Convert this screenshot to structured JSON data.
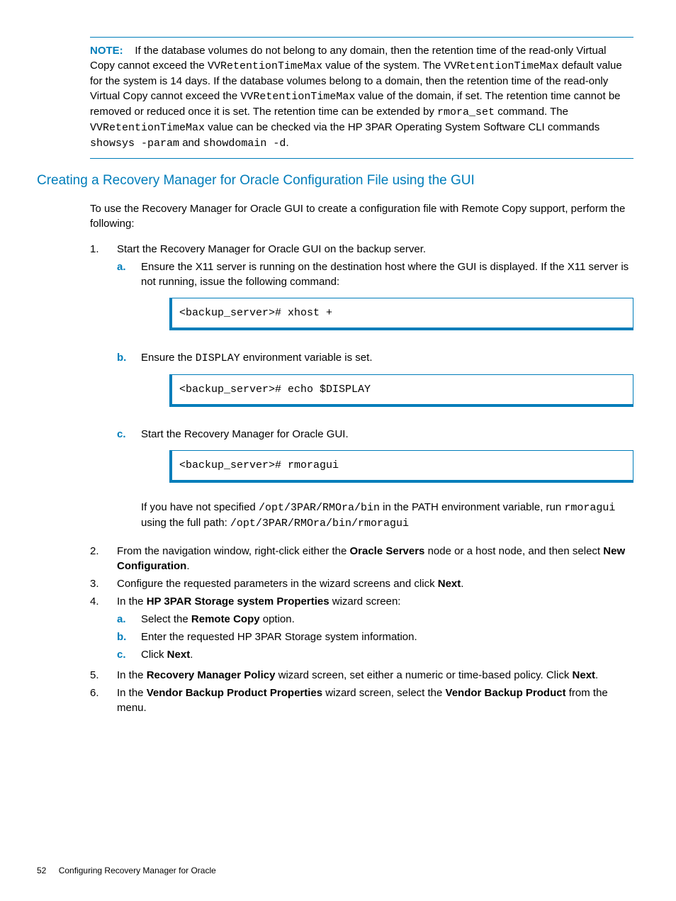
{
  "note": {
    "label": "NOTE:",
    "t1": "If the database volumes do not belong to any domain, then the retention time of the read-only Virtual Copy cannot exceed the ",
    "c1": "VVRetentionTimeMax",
    "t2": " value of the system. The ",
    "c2": "VVRetentionTimeMax",
    "t3": " default value for the system is 14 days. If the database volumes belong to a domain, then the retention time of the read-only Virtual Copy cannot exceed the ",
    "c3": "VVRetentionTimeMax",
    "t4": " value of the domain, if set. The retention time cannot be removed or reduced once it is set. The retention time can be extended by ",
    "c4": "rmora_set",
    "t5": " command. The ",
    "c5": "VVRetentionTimeMax",
    "t6": " value can be checked via the HP 3PAR Operating System Software CLI commands ",
    "c6": "showsys -param",
    "t7": " and ",
    "c7": "showdomain -d",
    "t8": "."
  },
  "heading": "Creating a Recovery Manager for Oracle Configuration File using the GUI",
  "intro": "To use the Recovery Manager for Oracle GUI to create a configuration file with Remote Copy support, perform the following:",
  "step1": {
    "num": "1.",
    "text": "Start the Recovery Manager for Oracle GUI on the backup server.",
    "a": {
      "m": "a.",
      "text": "Ensure the X11 server is running on the destination host where the GUI is displayed. If the X11 server is not running, issue the following command:",
      "cmd": "<backup_server># xhost +"
    },
    "b": {
      "m": "b.",
      "pre": "Ensure the ",
      "code": "DISPLAY",
      "post": " environment variable is set.",
      "cmd": "<backup_server># echo $DISPLAY"
    },
    "c": {
      "m": "c.",
      "text": "Start the Recovery Manager for Oracle GUI.",
      "cmd": "<backup_server># rmoragui",
      "after_t1": "If you have not specified ",
      "after_c1": "/opt/3PAR/RMOra/bin",
      "after_t2": " in the PATH environment variable, run ",
      "after_c2": "rmoragui",
      "after_t3": " using the full path: ",
      "after_c3": "/opt/3PAR/RMOra/bin/rmoragui"
    }
  },
  "step2": {
    "num": "2.",
    "t1": "From the navigation window, right-click either the ",
    "b1": "Oracle Servers",
    "t2": " node or a host node, and then select ",
    "b2": "New Configuration",
    "t3": "."
  },
  "step3": {
    "num": "3.",
    "t1": "Configure the requested parameters in the wizard screens and click ",
    "b1": "Next",
    "t2": "."
  },
  "step4": {
    "num": "4.",
    "t1": "In the ",
    "b1": "HP 3PAR Storage system Properties",
    "t2": " wizard screen:",
    "a": {
      "m": "a.",
      "t1": "Select the ",
      "b1": "Remote Copy",
      "t2": " option."
    },
    "b": {
      "m": "b.",
      "text": "Enter the requested HP 3PAR Storage system information."
    },
    "c": {
      "m": "c.",
      "t1": "Click ",
      "b1": "Next",
      "t2": "."
    }
  },
  "step5": {
    "num": "5.",
    "t1": "In the ",
    "b1": "Recovery Manager Policy",
    "t2": " wizard screen, set either a numeric or time-based policy. Click ",
    "b2": "Next",
    "t3": "."
  },
  "step6": {
    "num": "6.",
    "t1": "In the ",
    "b1": "Vendor Backup Product Properties",
    "t2": " wizard screen, select the ",
    "b2": "Vendor Backup Product",
    "t3": " from the menu."
  },
  "footer": {
    "page": "52",
    "title": "Configuring Recovery Manager for Oracle"
  }
}
